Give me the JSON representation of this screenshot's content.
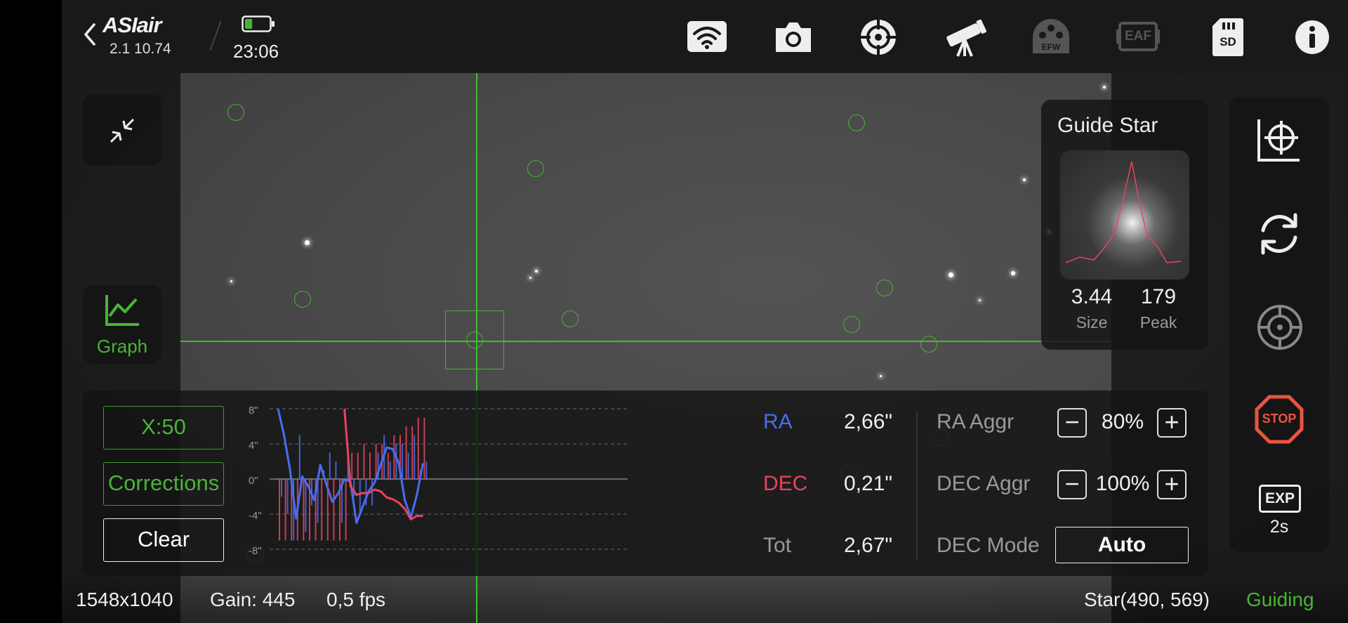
{
  "header": {
    "logo": "ASIair",
    "version": "2.1 10.74",
    "time": "23:06",
    "battery_level": 0.3,
    "icons": [
      "back-icon",
      "wifi-icon",
      "camera-icon",
      "focus-target-icon",
      "telescope-icon",
      "efw-icon",
      "eaf-icon",
      "sd-card-icon",
      "info-icon"
    ],
    "efw_label": "EFW",
    "eaf_label": "EAF",
    "sd_label": "SD"
  },
  "left": {
    "collapse_icon": "collapse-arrows-icon",
    "graph_label": "Graph"
  },
  "guide_star": {
    "title": "Guide Star",
    "size_value": "3.44",
    "size_label": "Size",
    "peak_value": "179",
    "peak_label": "Peak"
  },
  "right_tools": {
    "exposure_icon_label": "EXP",
    "exposure_value": "2s",
    "stop_label": "STOP"
  },
  "graph": {
    "x_scale_label": "X:50",
    "corrections_label": "Corrections",
    "clear_label": "Clear",
    "y_ticks": [
      "8\"",
      "4\"",
      "0\"",
      "-4\"",
      "-8\""
    ],
    "ra_label": "RA",
    "ra_value": "2,66\"",
    "dec_label": "DEC",
    "dec_value": "0,21\"",
    "tot_label": "Tot",
    "tot_value": "2,67\"",
    "ra_color": "#4a6cf0",
    "dec_color": "#e8445e",
    "ra_aggr_label": "RA Aggr",
    "ra_aggr_value": "80%",
    "dec_aggr_label": "DEC Aggr",
    "dec_aggr_value": "100%",
    "dec_mode_label": "DEC Mode",
    "dec_mode_value": "Auto",
    "minus": "−",
    "plus": "+"
  },
  "status": {
    "resolution": "1548x1040",
    "gain": "Gain: 445",
    "fps": "0,5 fps",
    "star_pos": "Star(490, 569)",
    "state": "Guiding",
    "state_color": "#48b536"
  },
  "chart_data": {
    "type": "line",
    "ylim": [
      -8,
      8
    ],
    "y_ticks": [
      8,
      4,
      0,
      -4,
      -8
    ],
    "series": [
      {
        "name": "RA",
        "values": [
          8,
          5,
          1,
          -4.5,
          0.3,
          -0.8,
          -2.4,
          1.6,
          -0.6,
          -2.6,
          -1.6,
          0,
          -0.3,
          -5,
          -3.2,
          -1.4,
          -0.4,
          1.6,
          3.6,
          3.4,
          1.8,
          -2.4,
          -4.4,
          -1.8,
          1.8
        ]
      },
      {
        "name": "DEC",
        "values": [
          null,
          null,
          null,
          null,
          null,
          null,
          null,
          null,
          null,
          null,
          null,
          8,
          -0.8,
          -1.8,
          -1.6,
          -1.6,
          -1.2,
          -1.4,
          -2.1,
          -2.3,
          -2.7,
          -3.4,
          -4.6,
          -4.2,
          -4.2
        ]
      }
    ],
    "ra_bars": [
      -2,
      -4,
      -7,
      5,
      -6,
      -3,
      -5,
      1,
      3,
      2,
      -5,
      4,
      -2,
      -4,
      -3,
      -3,
      3,
      5,
      2,
      4,
      4,
      3,
      5,
      1,
      2
    ],
    "dec_bars": [
      -7,
      -7,
      -7,
      -7,
      -7,
      -7,
      -7,
      -7,
      -7,
      -7,
      -7,
      -7,
      3,
      3,
      4,
      3,
      4,
      4,
      3,
      5,
      5,
      6,
      6,
      7,
      7
    ]
  }
}
